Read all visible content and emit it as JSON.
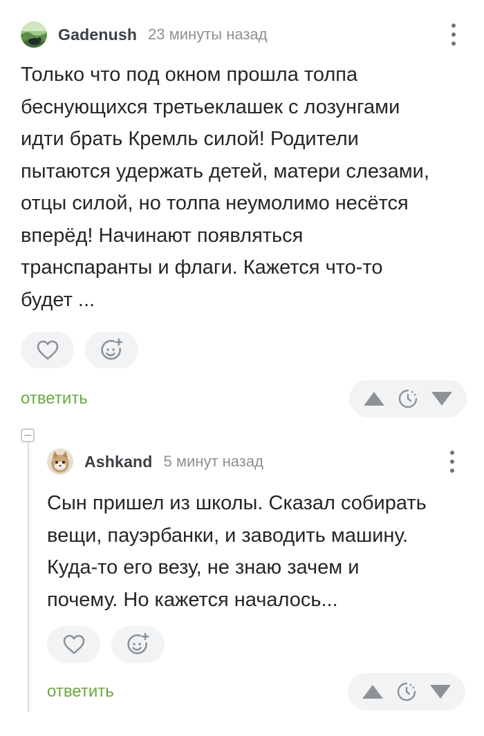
{
  "colors": {
    "accent_reply": "#6aa844",
    "button_bg": "#f2f3f5",
    "icon_gray": "#8d9296",
    "time_gray": "#8b8f93"
  },
  "comments": [
    {
      "author": "Gadenush",
      "time": "23 минуты назад",
      "avatar_icon": "forest-avatar",
      "text": "Только что под окном прошла толпа\nбеснующихся третьеклашек с лозунгами\nидти брать Кремль силой! Родители\nпытаются удержать детей, матери слезами,\nотцы силой, но толпа неумолимо несётся\nвперёд! Начинают появляться\nтранспаранты и флаги. Кажется что-то\nбудет ...",
      "reply_label": "ответить"
    },
    {
      "author": "Ashkand",
      "time": "5 минут назад",
      "avatar_icon": "cat-avatar",
      "text": "Сын пришел из школы. Сказал собирать\nвещи, пауэрбанки, и заводить машину.\nКуда-то его везу, не знаю зачем и\nпочему. Но кажется началось...",
      "reply_label": "ответить"
    }
  ]
}
